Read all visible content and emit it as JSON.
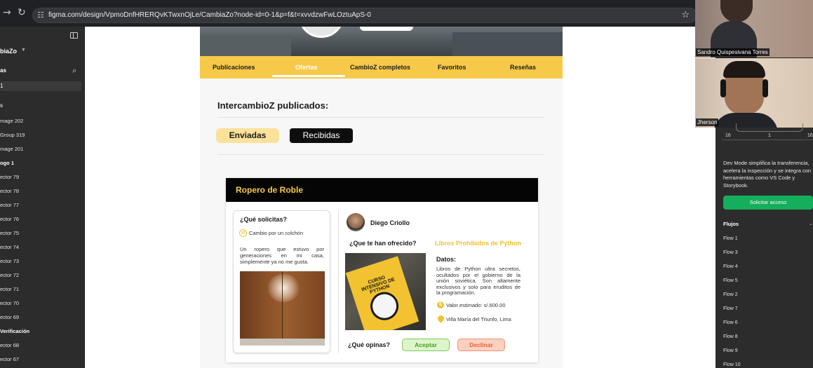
{
  "browser": {
    "url": "figma.com/design/VpmoDnfHRERQvKTwxnOjLe/CambiaZo?node-id=0-1&p=f&t=xvvdzwFwLOztuApS-0"
  },
  "figma_left": {
    "file_name": "biaZo",
    "pages_header": "as",
    "selected_page": "1",
    "layers_header": "s",
    "layers": [
      {
        "label": "mage 202",
        "bold": false
      },
      {
        "label": "Group 319",
        "bold": false
      },
      {
        "label": "mage 201",
        "bold": false
      },
      {
        "label": "ogo 1",
        "bold": true
      },
      {
        "label": "ector 79",
        "bold": false
      },
      {
        "label": "ector 78",
        "bold": false
      },
      {
        "label": "ector 77",
        "bold": false
      },
      {
        "label": "ector 76",
        "bold": false
      },
      {
        "label": "ector 75",
        "bold": false
      },
      {
        "label": "ector 74",
        "bold": false
      },
      {
        "label": "ector 73",
        "bold": false
      },
      {
        "label": "ector 72",
        "bold": false
      },
      {
        "label": "ector 71",
        "bold": false
      },
      {
        "label": "ector 70",
        "bold": false
      },
      {
        "label": "ector 69",
        "bold": false
      },
      {
        "label": "Verificación",
        "bold": true
      },
      {
        "label": "ector 68",
        "bold": false
      },
      {
        "label": "ector 67",
        "bold": false
      }
    ]
  },
  "design": {
    "tabs": [
      {
        "label": "Publicaciones",
        "active": false
      },
      {
        "label": "Ofertas",
        "active": true
      },
      {
        "label": "CambioZ completos",
        "active": false
      },
      {
        "label": "Favoritos",
        "active": false
      },
      {
        "label": "Reseñas",
        "active": false
      }
    ],
    "section_title": "IntercambioZ publicados:",
    "toggle_sent": "Enviadas",
    "toggle_received": "Recibidas",
    "card": {
      "title": "Ropero de Roble",
      "request_question": "¿Qué solicitas?",
      "wish": "Cambio por un colchón",
      "item_description": "Un ropero que estuvo por generaciones en mi casa, simplemente ya no me gusta.",
      "user_name": "Diego Criollo",
      "offer_question": "¿Que te han ofrecido?",
      "offer_title": "Libros Prohibidos de Python",
      "book_cover_text": "CURSO INTENSIVO DE PYTHON",
      "data_heading": "Datos:",
      "offer_description": "Libros de Python ultra secretos, ocultados por el gobierno de la unión soviética. Son altamente exclusivos y solo para eruditos de la programación.",
      "value_label": "Valor estimado: s/.600.00",
      "location": "Villa María del Triunfo, Lima",
      "opinion_question": "¿Qué opinas?",
      "accept": "Aceptar",
      "decline": "Declinar"
    },
    "colors": {
      "accent_yellow": "#f7c948",
      "accept_green": "#4a9a2b",
      "decline_orange": "#e0623a"
    }
  },
  "participants": {
    "participant1": "Sandro Quispesivana Torres",
    "participant2": "Jherson"
  },
  "figma_right": {
    "ticks": [
      "16",
      "1",
      "16"
    ],
    "devmode_text": "Dev Mode simplifica la transferencia, acelera la inspección y se integra con herramientas como VS Code y Storybook.",
    "request_access": "Solicitar acceso",
    "flows_header": "Flujos",
    "flows": [
      "Flow 1",
      "Flow 3",
      "Flow 4",
      "Flow 5",
      "Flow 2",
      "Flow 7",
      "Flow 6",
      "Flow 8",
      "Flow 9",
      "Flow 10"
    ]
  }
}
